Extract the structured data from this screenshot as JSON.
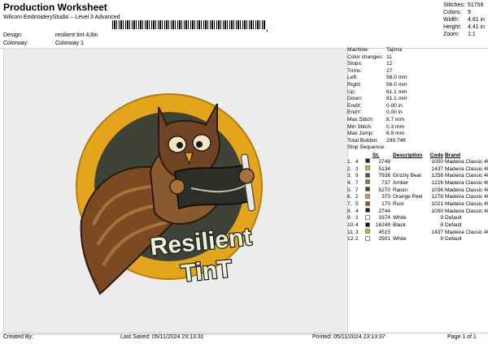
{
  "header": {
    "title": "Production Worksheet",
    "subtitle": "Wilcom EmbroideryStudio – Level 3 Advanced",
    "barcode_tail": ","
  },
  "meta": {
    "design_label": "Design:",
    "design_value": "resilient tint 4,8in",
    "colorway_label": "Colorway:",
    "colorway_value": "Colorway 1"
  },
  "stats": [
    {
      "k": "Stitches:",
      "v": "51756"
    },
    {
      "k": "Colors:",
      "v": "9"
    },
    {
      "k": "Width:",
      "v": "4.81 in"
    },
    {
      "k": "Height:",
      "v": "4.41 in"
    },
    {
      "k": "Zoom:",
      "v": "1:1"
    }
  ],
  "design_image": {
    "text_line1": "Resilient",
    "text_line2": "TinT",
    "colors": {
      "ring": "#e3a51c",
      "inner": "#3f4236",
      "feather": "#7b4a23",
      "feather_light": "#a9713a",
      "text": "#e9f1d6"
    }
  },
  "properties": [
    {
      "k": "Machine:",
      "v": "Tajima"
    },
    {
      "k": "Color changes:",
      "v": "11"
    },
    {
      "k": "Stops:",
      "v": "12"
    },
    {
      "k": "Trims:",
      "v": "27"
    },
    {
      "k": "Left:",
      "v": "56.0 mm"
    },
    {
      "k": "Right:",
      "v": "56.0 mm"
    },
    {
      "k": "Up:",
      "v": "61.1 mm"
    },
    {
      "k": "Down:",
      "v": "61.1 mm"
    },
    {
      "k": "EndX:",
      "v": "0.00 in"
    },
    {
      "k": "EndY:",
      "v": "0.00 in"
    },
    {
      "k": "Max Stitch:",
      "v": "8.7 mm"
    },
    {
      "k": "Min Stitch:",
      "v": "0.3 mm"
    },
    {
      "k": "Max Jump:",
      "v": "6.9 mm"
    },
    {
      "k": "Total Bobbin:",
      "v": "299.74ft"
    }
  ],
  "sequence": {
    "label": "Stop Sequence:",
    "headers": {
      "st": "St.",
      "description": "Description",
      "code": "Code",
      "brand": "Brand"
    },
    "rows": [
      {
        "n": "1.",
        "c": "4",
        "color": "#231f20",
        "st": "2749",
        "desc": "",
        "code": "1000",
        "brand": "Madeira Classic 40"
      },
      {
        "n": "2.",
        "c": "3",
        "color": "#f0a81e",
        "st": "5134",
        "desc": "",
        "code": "1437",
        "brand": "Madeira Classic 40"
      },
      {
        "n": "3.",
        "c": "9",
        "color": "#6a4a2d",
        "st": "7938",
        "desc": "Grizzly Bear",
        "code": "1258",
        "brand": "Madeira Classic 40"
      },
      {
        "n": "4.",
        "c": "7",
        "color": "#a66b2e",
        "st": "737",
        "desc": "Amber",
        "code": "1226",
        "brand": "Madeira Classic 40"
      },
      {
        "n": "5.",
        "c": "7",
        "color": "#6e2d24",
        "st": "5270",
        "desc": "Raisin",
        "code": "1036",
        "brand": "Madeira Classic 40"
      },
      {
        "n": "6.",
        "c": "2",
        "color": "#f28a2c",
        "st": "373",
        "desc": "Orange Peel",
        "code": "1278",
        "brand": "Madeira Classic 40"
      },
      {
        "n": "7.",
        "c": "5",
        "color": "#9a4a28",
        "st": "170",
        "desc": "Rust",
        "code": "1021",
        "brand": "Madeira Classic 40"
      },
      {
        "n": "8.",
        "c": "4",
        "color": "#231f20",
        "st": "2744",
        "desc": "",
        "code": "1000",
        "brand": "Madeira Classic 40"
      },
      {
        "n": "9.",
        "c": "2",
        "color": "#ffffff",
        "st": "3374",
        "desc": "White",
        "code": "9",
        "brand": "Default"
      },
      {
        "n": "10.",
        "c": "4",
        "color": "#111111",
        "st": "16249",
        "desc": "Black",
        "code": "8",
        "brand": "Default"
      },
      {
        "n": "11.",
        "c": "3",
        "color": "#f0a81e",
        "st": "4515",
        "desc": "",
        "code": "1437",
        "brand": "Madeira Classic 40"
      },
      {
        "n": "12.",
        "c": "2",
        "color": "#ffffff",
        "st": "2501",
        "desc": "White",
        "code": "9",
        "brand": "Default"
      }
    ]
  },
  "footer": {
    "created_by": "Created By:",
    "last_saved": "Last Saved: 05/11/2024 23:13:31",
    "printed": "Printed: 05/11/2024 23:13:37",
    "page": "Page 1 of 1"
  }
}
